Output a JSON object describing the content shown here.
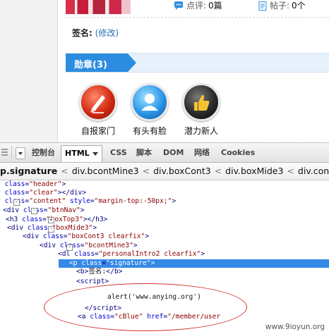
{
  "page": {
    "stats": [
      {
        "icon": "comment-icon",
        "label": "点评:",
        "value": "0篇"
      },
      {
        "icon": "post-icon",
        "label": "帖子:",
        "value": "0个"
      }
    ],
    "signature": {
      "label": "签名:",
      "edit_link": "(修改)"
    },
    "medals_title": "勋章(3)",
    "medals": [
      {
        "name": "自报家门",
        "icon": "pen-medal-icon"
      },
      {
        "name": "有头有脸",
        "icon": "avatar-medal-icon"
      },
      {
        "name": "潜力新人",
        "icon": "thumbs-up-medal-icon"
      }
    ]
  },
  "devtools": {
    "tabs": [
      "控制台",
      "HTML",
      "CSS",
      "脚本",
      "DOM",
      "网络",
      "Cookies"
    ],
    "active_tab": "HTML",
    "breadcrumb": [
      "p.signature",
      "div.bcontMine3",
      "div.boxCont3",
      "div.boxMide3",
      "div.content"
    ],
    "lines": [
      {
        "indent": 0,
        "html": "<span class=\"tag\">v</span> <span class=\"an\">class</span>=<span class=\"av\">\"header\"</span><span class=\"tag\">&gt;</span>",
        "twisty": ""
      },
      {
        "indent": 0,
        "html": "<span class=\"tag\">v</span> <span class=\"an\">class</span>=<span class=\"av\">\"clear\"</span><span class=\"tag\">&gt;&lt;/div&gt;</span>",
        "twisty": ""
      },
      {
        "indent": 0,
        "html": "<span class=\"tag\">v</span> <span class=\"an\">class</span>=<span class=\"av\">\"content\"</span> <span class=\"an\">style</span>=<span class=\"av\">\"margin-top:-50px;\"</span><span class=\"tag\">&gt;</span>",
        "twisty": ""
      },
      {
        "indent": 1,
        "html": "<span class=\"tag\">&lt;div</span> <span class=\"an\">class</span>=<span class=\"av\">\"btnNav\"</span><span class=\"tag\">&gt;</span>",
        "twisty": ""
      },
      {
        "indent": 1,
        "html": "<span class=\"tag\">&lt;h3</span> <span class=\"an\">class</span>=<span class=\"av\">\"boxTop3\"</span><span class=\"tag\">&gt;&lt;/h3&gt;</span>",
        "twisty": ""
      },
      {
        "indent": 1,
        "html": "<span class=\"tag\">&lt;div</span> <span class=\"an\">class</span>=<span class=\"av\">\"boxMide3\"</span><span class=\"tag\">&gt;</span>",
        "twisty": ""
      },
      {
        "indent": 2,
        "html": "<span class=\"tag\">&lt;div</span> <span class=\"an\">class</span>=<span class=\"av\">\"boxCont3 clearfix\"</span><span class=\"tag\">&gt;</span>",
        "twisty": "-"
      },
      {
        "indent": 3,
        "html": "<span class=\"tag\">&lt;div</span> <span class=\"an\">class</span>=<span class=\"av\">\"bcontMine3\"</span><span class=\"tag\">&gt;</span>",
        "twisty": "-"
      },
      {
        "indent": 4,
        "html": "<span class=\"tag\">&lt;dl</span> <span class=\"an\">class</span>=<span class=\"av\">\"personalIntro2 clearfix\"</span><span class=\"tag\">&gt;</span>",
        "twisty": "+"
      },
      {
        "indent": 4,
        "html": "<span class=\"tag\">&lt;p</span> <span class=\"an\">class</span>=<span class=\"av\">\"signature\"</span><span class=\"tag\">&gt;</span>",
        "twisty": "-",
        "selected": true
      },
      {
        "indent": 5,
        "html": "<span class=\"tag\">&lt;b&gt;</span><span class=\"tx\">签名:</span><span class=\"tag\">&lt;/b&gt;</span>",
        "twisty": ""
      },
      {
        "indent": 5,
        "html": "<span class=\"tag\">&lt;script&gt;</span>",
        "twisty": "-"
      },
      {
        "indent": 6,
        "html": "<span class=\"tx\">alert('www.anying.org')</span>",
        "twisty": ""
      },
      {
        "indent": 5,
        "html": "<span class=\"tag\">&lt;/script&gt;</span>",
        "twisty": ""
      },
      {
        "indent": 5,
        "html": "<span class=\"tag\">&lt;a</span> <span class=\"an\">class</span>=<span class=\"av\">\"cBlue\"</span> <span class=\"an\">href</span>=<span class=\"av\">\"/member/user</span>",
        "twisty": ""
      }
    ]
  },
  "watermark": "www.9ioyun.org",
  "colors": {
    "accent": "#2c8de0",
    "selection": "#3589e6",
    "annotation": "#d3302a"
  }
}
